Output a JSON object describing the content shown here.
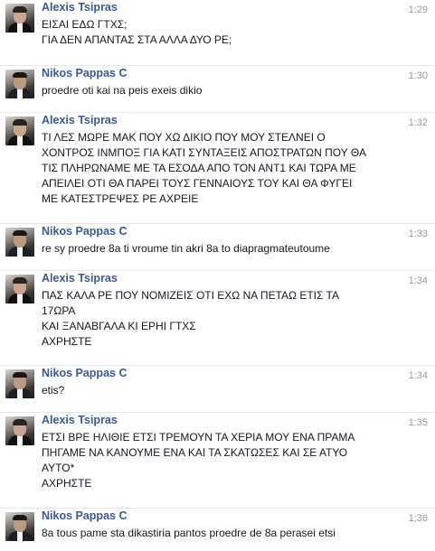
{
  "messages": [
    {
      "sender": "Alexis Tsipras",
      "avatar": "alexis-tsipras-avatar",
      "time": "1:29",
      "lines": [
        "ΕΙΣΑΙ ΕΔΩ ΓΤΧΣ;",
        "ΓΙΑ ΔΕΝ ΑΠΑΝΤΑΣ ΣΤΑ ΑΛΛΑ ΔΥΟ ΡΕ;"
      ]
    },
    {
      "sender": "Nikos Pappas C",
      "avatar": "nikos-pappas-avatar",
      "time": "1:30",
      "lines": [
        "proedre oti kai na peis exeis dikio"
      ]
    },
    {
      "sender": "Alexis Tsipras",
      "avatar": "alexis-tsipras-avatar",
      "time": "1:32",
      "lines": [
        "ΤΙ ΛΕΣ ΜΩΡΕ ΜΑΚ ΠΟΥ ΧΩ ΔΙΚΙΟ ΠΟΥ ΜΟΥ ΣΤΕΛΝΕΙ Ο",
        "ΧΟΝΤΡΟΣ ΙΝΜΠΟΞ ΓΙΑ ΚΑΤΙ ΣΥΝΤΑΞΕΙΣ ΑΠΟΣΤΡΑΤΩΝ ΠΟΥ ΘΑ",
        "ΤΙΣ ΠΛΗΡΩΝΑΜΕ ΜΕ ΤΑ ΕΣΟΔΑ ΑΠΟ ΤΟΝ ΑΝΤ1 ΚΑΙ ΤΩΡΑ ΜΕ",
        "ΑΠΕΙΛΕΙ ΟΤΙ ΘΑ ΠΑΡΕΙ ΤΟΥΣ ΓΕΝΝΑΙΟΥΣ ΤΟΥ ΚΑΙ ΘΑ ΦΥΓΕΙ",
        "ΜΕ ΚΑΤΕΣΤΡΕΨΕΣ ΡΕ ΑΧΡΕΙΕ"
      ]
    },
    {
      "sender": "Nikos Pappas C",
      "avatar": "nikos-pappas-avatar",
      "time": "1:33",
      "lines": [
        "re sy proedre 8a ti vroume tin akri 8a to diapragmateutoume"
      ]
    },
    {
      "sender": "Alexis Tsipras",
      "avatar": "alexis-tsipras-avatar",
      "time": "1:34",
      "lines": [
        "ΠΑΣ ΚΑΛΑ ΡΕ ΠΟΥ ΝΟΜΙΖΕΙΣ ΟΤΙ ΕΧΩ ΝΑ ΠΕΤΑΩ ΕΤΙΣ ΤΑ",
        "17ΩΡΑ",
        "ΚΑΙ ΞΑΝΑΒΓΑΛΑ ΚΙ ΕΡΗΙ ΓΤΧΣ",
        "ΑΧΡΗΣΤΕ"
      ]
    },
    {
      "sender": "Nikos Pappas C",
      "avatar": "nikos-pappas-avatar",
      "time": "1:34",
      "lines": [
        "etis?"
      ]
    },
    {
      "sender": "Alexis Tsipras",
      "avatar": "alexis-tsipras-avatar",
      "time": "1:35",
      "lines": [
        "ΕΤΣΙ ΒΡΕ ΗΛΙΘΙΕ ΕΤΣΙ ΤΡΕΜΟΥΝ ΤΑ ΧΕΡΙΑ ΜΟΥ ΕΝΑ ΠΡΑΜΑ",
        "ΠΗΓΑΜΕ ΝΑ ΚΑΝΟΥΜΕ ΕΝΑ ΚΑΙ ΤΑ ΣΚΑΤΩΣΕΣ ΚΑΙ ΣΕ ΑΤΥΟ",
        "ΑΥΤΟ*",
        "ΑΧΡΗΣΤΕ"
      ]
    },
    {
      "sender": "Nikos Pappas C",
      "avatar": "nikos-pappas-avatar",
      "time": "1:36",
      "lines": [
        "8a tous pame sta dikastiria pantos proedre de 8a perasei etsi"
      ]
    }
  ]
}
